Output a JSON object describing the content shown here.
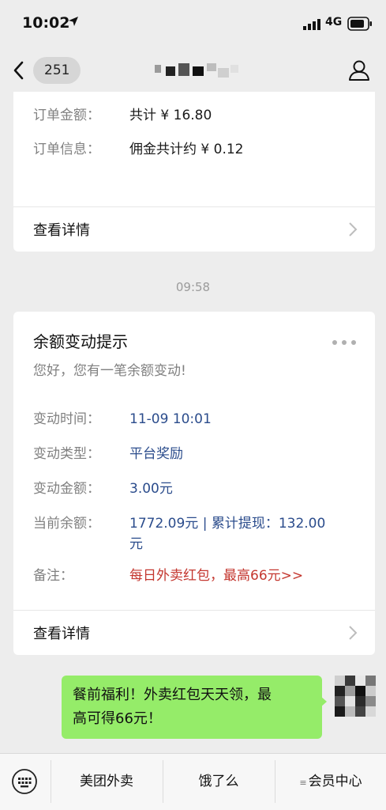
{
  "status_bar": {
    "time": "10:02",
    "network": "4G",
    "icons": [
      "location-arrow-icon",
      "signal-icon",
      "battery-icon"
    ]
  },
  "nav": {
    "unread_count": "251",
    "icons": [
      "back-chevron-icon",
      "profile-icon"
    ]
  },
  "order_card": {
    "rows": [
      {
        "key": "订单金额：",
        "value": "共计 ¥ 16.80"
      },
      {
        "key": "订单信息：",
        "value": "佣金共计约 ¥ 0.12"
      }
    ],
    "detail_label": "查看详情"
  },
  "timestamp": "09:58",
  "balance_card": {
    "title": "余额变动提示",
    "subtitle": "您好，您有一笔余额变动!",
    "rows": [
      {
        "key": "变动时间：",
        "value": "11-09 10:01"
      },
      {
        "key": "变动类型：",
        "value": "平台奖励"
      },
      {
        "key": "变动金额：",
        "value": "3.00元"
      },
      {
        "key": "当前余额：",
        "value": "1772.09元 | 累计提现：132.00",
        "value_line2": "元"
      },
      {
        "key": "备注：",
        "value": "每日外卖红包，最高66元>>"
      }
    ],
    "detail_label": "查看详情"
  },
  "message": {
    "line1": "餐前福利！外卖红包天天领，最",
    "line2": "高可得66元！"
  },
  "bottom_menu": {
    "items": [
      "美团外卖",
      "饿了么",
      "会员中心"
    ],
    "menu_marker": "≡"
  },
  "colors": {
    "background": "#ededed",
    "card": "#ffffff",
    "bubble": "#95ec69",
    "value_blue": "#2b4c8c",
    "remark_red": "#c4372f",
    "label_gray": "#808080"
  }
}
